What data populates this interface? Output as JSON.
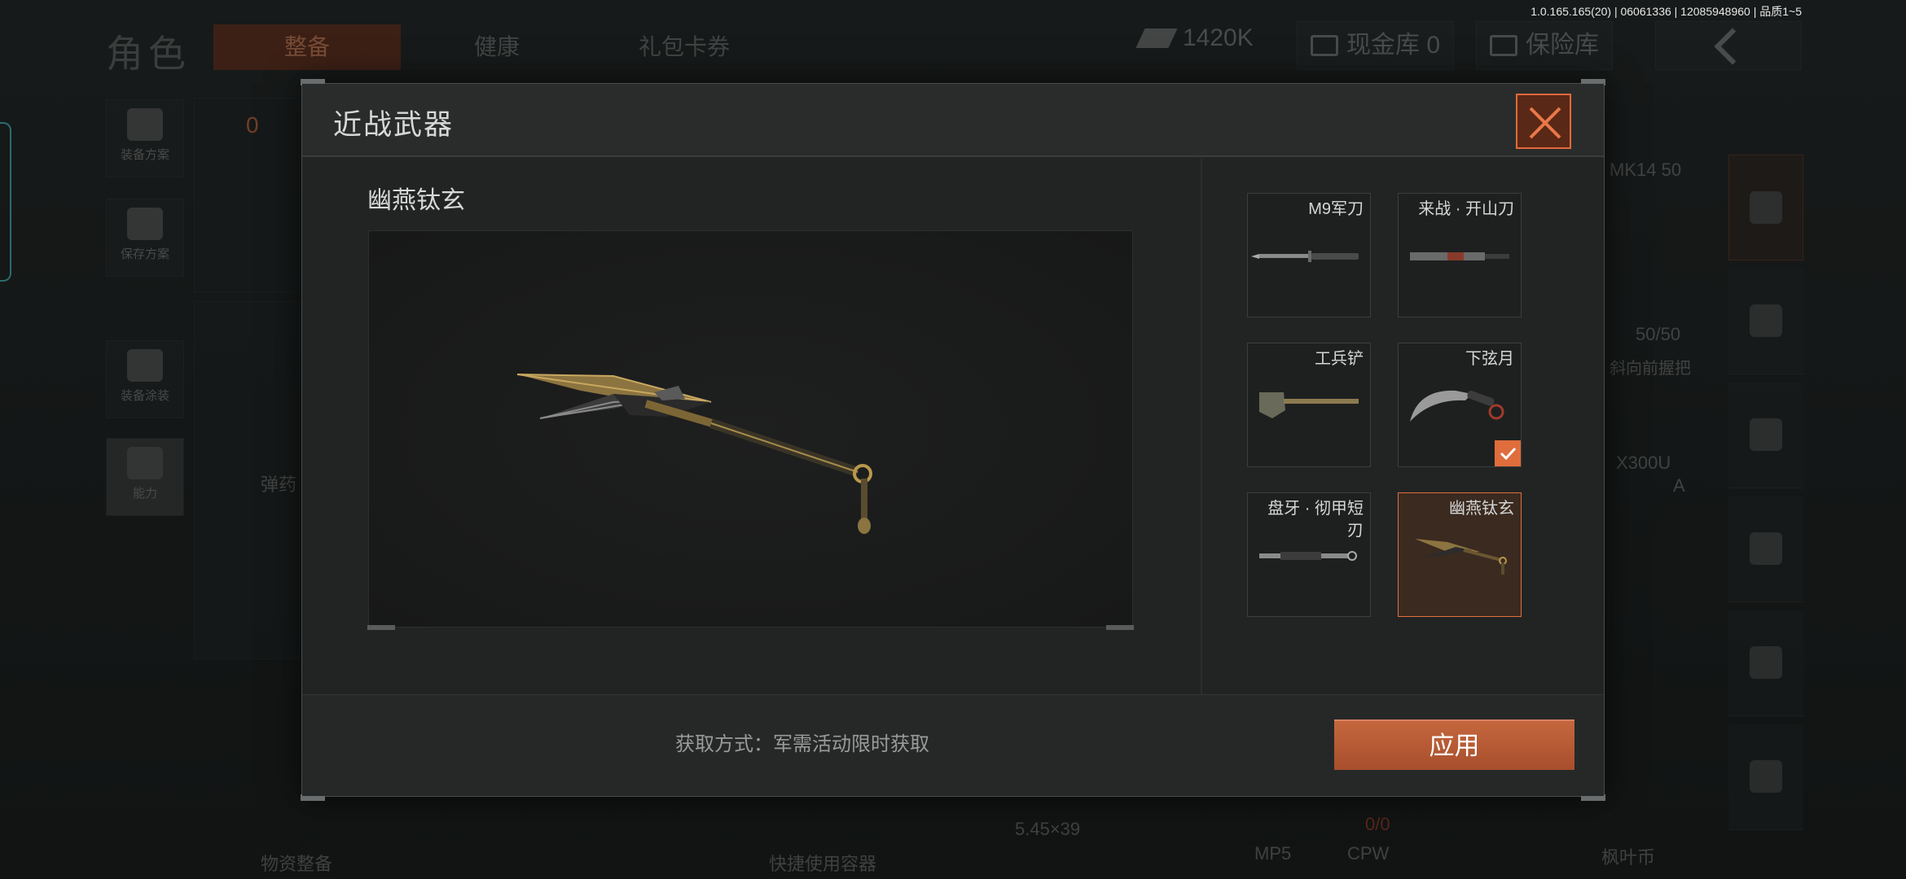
{
  "version": "1.0.165.165(20) | 06061336 | 12085948960 | 品质1~5",
  "background": {
    "title": "角色",
    "tabs": [
      "整备",
      "健康",
      "礼包卡券"
    ],
    "money": "1420K",
    "cash_vault": "现金库 0",
    "safe": "保险库",
    "side": [
      "装备方案",
      "保存方案",
      "装备涂装",
      "能力"
    ],
    "ammo_tab": "弹药",
    "ammo_caliber": "5.45×39",
    "ammo_count": "0/0",
    "gun_mag": "MK14 50",
    "gun_mag_count": "50/50",
    "grip": "斜向前握把",
    "light": "X300U",
    "light_sub": "A",
    "bottom_weapons": [
      "MP5",
      "CPW"
    ],
    "bottom_left": "物资整备",
    "bottom_mid": "快捷使用容器",
    "bottom_right": "枫叶币",
    "vest_count": "0"
  },
  "dialog": {
    "title": "近战武器",
    "selected_name": "幽燕钛玄",
    "acquire_text": "获取方式：军需活动限时获取",
    "apply_label": "应用",
    "items": [
      {
        "label": "M9军刀",
        "equipped": false,
        "selected": false
      },
      {
        "label": "来战 · 开山刀",
        "equipped": false,
        "selected": false
      },
      {
        "label": "工兵铲",
        "equipped": false,
        "selected": false
      },
      {
        "label": "下弦月",
        "equipped": true,
        "selected": false
      },
      {
        "label": "盘牙 · 彻甲短刃",
        "equipped": false,
        "selected": false
      },
      {
        "label": "幽燕钛玄",
        "equipped": false,
        "selected": true
      }
    ]
  },
  "colors": {
    "accent": "#e0703c",
    "apply": "#b85a33"
  }
}
